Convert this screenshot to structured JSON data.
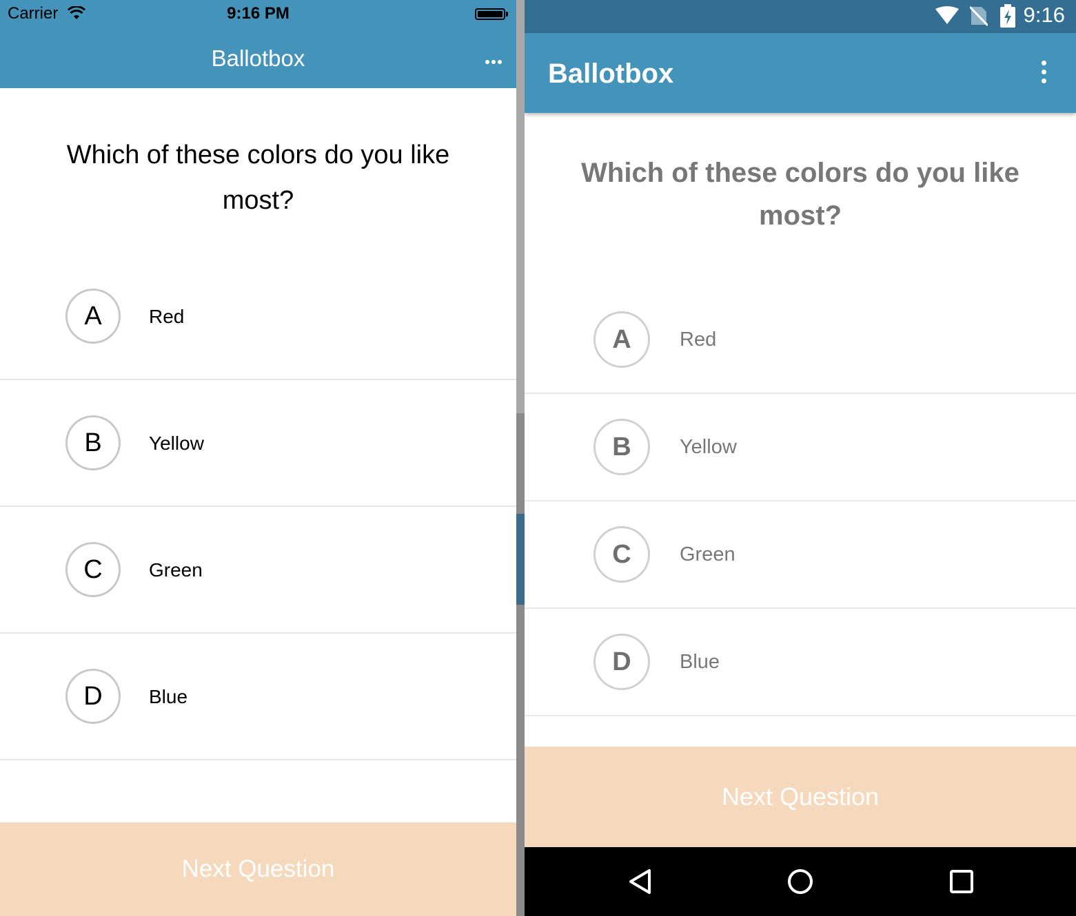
{
  "ios": {
    "status": {
      "carrier": "Carrier",
      "time": "9:16 PM"
    },
    "header": {
      "title": "Ballotbox",
      "more_icon": "ellipsis-icon"
    },
    "question": "Which of these colors do you like most?",
    "options": [
      {
        "letter": "A",
        "label": "Red"
      },
      {
        "letter": "B",
        "label": "Yellow"
      },
      {
        "letter": "C",
        "label": "Green"
      },
      {
        "letter": "D",
        "label": "Blue"
      }
    ],
    "next_button": "Next Question"
  },
  "android": {
    "status": {
      "time": "9:16"
    },
    "header": {
      "title": "Ballotbox",
      "more_icon": "vertical-dots-icon"
    },
    "question": "Which of these colors do you like most?",
    "options": [
      {
        "letter": "A",
        "label": "Red"
      },
      {
        "letter": "B",
        "label": "Yellow"
      },
      {
        "letter": "C",
        "label": "Green"
      },
      {
        "letter": "D",
        "label": "Blue"
      }
    ],
    "next_button": "Next Question",
    "nav": [
      "back-icon",
      "home-icon",
      "recents-icon"
    ]
  },
  "colors": {
    "header": "#4393bb",
    "android_status": "#346f93",
    "button_disabled": "#f6d8bd",
    "divider": "#e6e6e6"
  }
}
